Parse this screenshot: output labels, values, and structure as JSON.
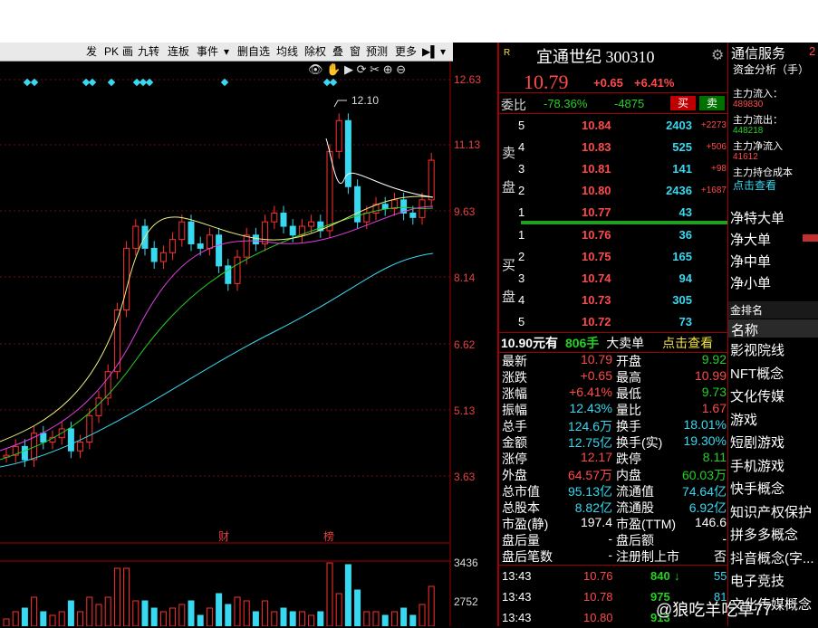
{
  "toolbar": {
    "items": [
      "发",
      "PK",
      "画",
      "九转",
      "连板",
      "事件",
      "▾",
      "删自选",
      "均线",
      "除权",
      "叠",
      "窗",
      "预测",
      "更多",
      "▶▌",
      "▾"
    ]
  },
  "chart": {
    "price_ticks": [
      "12.63",
      "11.13",
      "9.63",
      "8.14",
      "6.62",
      "5.13",
      "3.63"
    ],
    "volume_ticks": [
      "3436",
      "2752"
    ],
    "peak_label": "12.10",
    "event_markers": [
      "财",
      "榜"
    ],
    "toolbar_icons": [
      "eye-icon",
      "hand-icon",
      "play-icon",
      "forward-icon",
      "scissors-icon",
      "plus-icon",
      "minus-icon"
    ]
  },
  "chart_data": {
    "type": "candlestick",
    "series": [
      {
        "name": "K",
        "values": [
          4.1,
          4.3,
          4.0,
          4.6,
          4.4,
          4.5,
          4.7,
          4.2,
          4.4,
          5.0,
          5.4,
          6.0,
          7.4,
          8.8,
          9.3,
          8.8,
          8.5,
          8.7,
          9.0,
          9.4,
          8.9,
          8.8,
          9.1,
          8.4,
          8.0,
          8.6,
          9.1,
          8.9,
          9.4,
          9.6,
          9.3,
          9.1,
          9.3,
          9.4,
          9.2,
          11.0,
          11.7,
          10.2,
          9.4,
          9.6,
          9.8,
          9.7,
          9.9,
          9.6,
          9.5,
          9.9,
          10.8
        ]
      }
    ]
  },
  "stock": {
    "name": "宜通世纪",
    "code": "300310",
    "r_badge": "R",
    "price": "10.79",
    "change": "+0.65",
    "change_pct": "+6.41%",
    "weibi_label": "委比",
    "weibi_value": "-78.36%",
    "weicha_value": "-4875",
    "buy_btn": "买",
    "sell_btn": "卖"
  },
  "asks": [
    {
      "level": "5",
      "price": "10.84",
      "vol": "2403",
      "delta": "+2273"
    },
    {
      "level": "4",
      "price": "10.83",
      "vol": "525",
      "delta": "+506"
    },
    {
      "level": "3",
      "price": "10.81",
      "vol": "141",
      "delta": "+98"
    },
    {
      "level": "2",
      "price": "10.80",
      "vol": "2436",
      "delta": "+1687"
    },
    {
      "level": "1",
      "price": "10.77",
      "vol": "43",
      "delta": ""
    }
  ],
  "bids": [
    {
      "level": "1",
      "price": "10.76",
      "vol": "36"
    },
    {
      "level": "2",
      "price": "10.75",
      "vol": "165"
    },
    {
      "level": "3",
      "price": "10.74",
      "vol": "94"
    },
    {
      "level": "4",
      "price": "10.73",
      "vol": "305"
    },
    {
      "level": "5",
      "price": "10.72",
      "vol": "73"
    }
  ],
  "ask_label_1": "卖",
  "ask_label_2": "盘",
  "bid_label_1": "买",
  "bid_label_2": "盘",
  "big_order": {
    "price": "10.90元有",
    "vol": "806手",
    "label": "大卖单",
    "link": "点击查看"
  },
  "stats_left": [
    {
      "k": "最新",
      "v": "10.79",
      "c": "red"
    },
    {
      "k": "涨跌",
      "v": "+0.65",
      "c": "red"
    },
    {
      "k": "涨幅",
      "v": "+6.41%",
      "c": "red"
    },
    {
      "k": "振幅",
      "v": "12.43%",
      "c": "cyan"
    },
    {
      "k": "总手",
      "v": "124.6万",
      "c": "cyan"
    },
    {
      "k": "金额",
      "v": "12.75亿",
      "c": "cyan"
    },
    {
      "k": "涨停",
      "v": "12.17",
      "c": "red"
    },
    {
      "k": "外盘",
      "v": "64.57万",
      "c": "red"
    },
    {
      "k": "总市值",
      "v": "95.13亿",
      "c": "cyan"
    },
    {
      "k": "总股本",
      "v": "8.82亿",
      "c": "cyan"
    },
    {
      "k": "市盈(静)",
      "v": "197.4",
      "c": "white"
    },
    {
      "k": "盘后量",
      "v": "-",
      "c": "white"
    },
    {
      "k": "盘后笔数",
      "v": "-",
      "c": "white"
    }
  ],
  "stats_right": [
    {
      "k": "开盘",
      "v": "9.92",
      "c": "green"
    },
    {
      "k": "最高",
      "v": "10.99",
      "c": "red"
    },
    {
      "k": "最低",
      "v": "9.73",
      "c": "green"
    },
    {
      "k": "量比",
      "v": "1.67",
      "c": "red"
    },
    {
      "k": "换手",
      "v": "18.01%",
      "c": "cyan"
    },
    {
      "k": "换手(实)",
      "v": "19.30%",
      "c": "cyan"
    },
    {
      "k": "跌停",
      "v": "8.11",
      "c": "green"
    },
    {
      "k": "内盘",
      "v": "60.03万",
      "c": "green"
    },
    {
      "k": "流通值",
      "v": "74.64亿",
      "c": "cyan"
    },
    {
      "k": "流通股",
      "v": "6.92亿",
      "c": "cyan"
    },
    {
      "k": "市盈(TTM)",
      "v": "146.6",
      "c": "white"
    },
    {
      "k": "盘后额",
      "v": "-",
      "c": "white"
    },
    {
      "k": "注册制上市",
      "v": "否",
      "c": "white"
    }
  ],
  "ticks": [
    {
      "time": "13:43",
      "price": "10.76",
      "vol": "840",
      "arrow": "↓",
      "n": "55"
    },
    {
      "time": "13:43",
      "price": "10.78",
      "vol": "975",
      "arrow": "",
      "n": "81"
    },
    {
      "time": "13:43",
      "price": "10.80",
      "vol": "913",
      "arrow": "",
      "n": ""
    }
  ],
  "right_panel": {
    "sector": "通信服务",
    "sector_num": "2",
    "fund_title": "资金分析（手）",
    "inflow_label": "主力流入：",
    "inflow_value": "489830",
    "outflow_label": "主力流出：",
    "outflow_value": "448218",
    "net_label": "主力净流入",
    "net_value": "41612",
    "hold_label": "主力持仓成本",
    "hold_link": "点击查看",
    "net_items": [
      "净特大单",
      "净大单",
      "净中单",
      "净小单"
    ],
    "rank_title": "金排名",
    "name_header": "名称",
    "concepts": [
      "影视院线",
      "NFT概念",
      "文化传媒",
      "游戏",
      "短剧游戏",
      "手机游戏",
      "快手概念",
      "知识产权保护",
      "拼多多概念",
      "抖音概念(字...",
      "电子竞技",
      "文化传媒概念"
    ]
  },
  "watermark": "@狼吃羊吃草77"
}
